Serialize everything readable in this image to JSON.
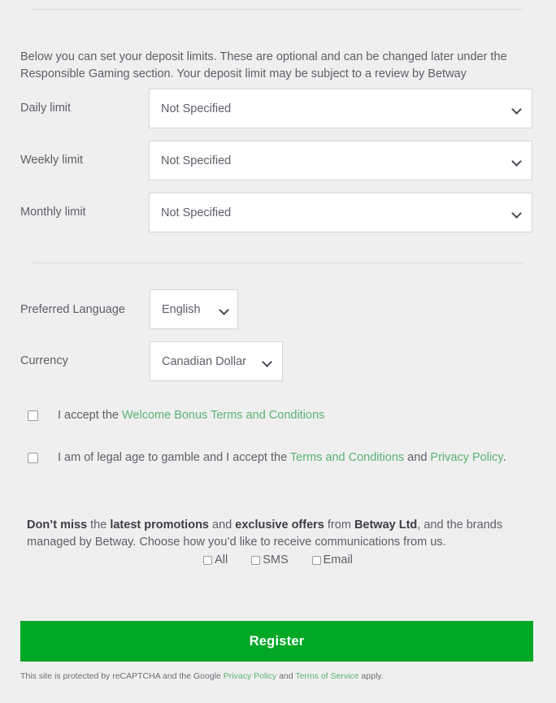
{
  "theme": {
    "background": "#efefef",
    "text": "#5e5e68",
    "link_green": "#5cb270",
    "button_green": "#00a826",
    "divider": "#dcdcdc",
    "field_border": "#d5d5d5"
  },
  "intro": {
    "text": "Below you can set your deposit limits. These are optional and can be changed later under the Responsible Gaming section. Your deposit limit may be subject to a review by Betway"
  },
  "deposit_limits": [
    {
      "label": "Daily limit",
      "value": "Not Specified"
    },
    {
      "label": "Weekly limit",
      "value": "Not Specified"
    },
    {
      "label": "Monthly limit",
      "value": "Not Specified"
    }
  ],
  "preferences": {
    "language": {
      "label": "Preferred Language",
      "value": "English"
    },
    "currency": {
      "label": "Currency",
      "value": "Canadian Dollar"
    }
  },
  "terms": {
    "bonus": {
      "checked": false,
      "prefix": "I accept the ",
      "link": "Welcome Bonus Terms and Conditions",
      "suffix": ""
    },
    "age": {
      "checked": false,
      "prefix": "I am of legal age to gamble and I accept the ",
      "link1": "Terms and Conditions",
      "middle": " and ",
      "link2": "Privacy Policy",
      "suffix": "."
    }
  },
  "promo": {
    "b1": "Don’t miss",
    "t1": " the ",
    "b2": "latest promotions",
    "t2": " and ",
    "b3": "exclusive offers",
    "t3": " from ",
    "b4": "Betway Ltd",
    "t4": ", and the brands managed by Betway. Choose how you’d like to receive communications from us."
  },
  "communications": [
    {
      "label": "All",
      "checked": false
    },
    {
      "label": "SMS",
      "checked": false
    },
    {
      "label": "Email",
      "checked": false
    }
  ],
  "register": {
    "label": "Register"
  },
  "recaptcha": {
    "prefix": "This site is protected by reCAPTCHA and the Google ",
    "link1": "Privacy Policy",
    "middle": " and ",
    "link2": "Terms of Service",
    "suffix": " apply."
  }
}
